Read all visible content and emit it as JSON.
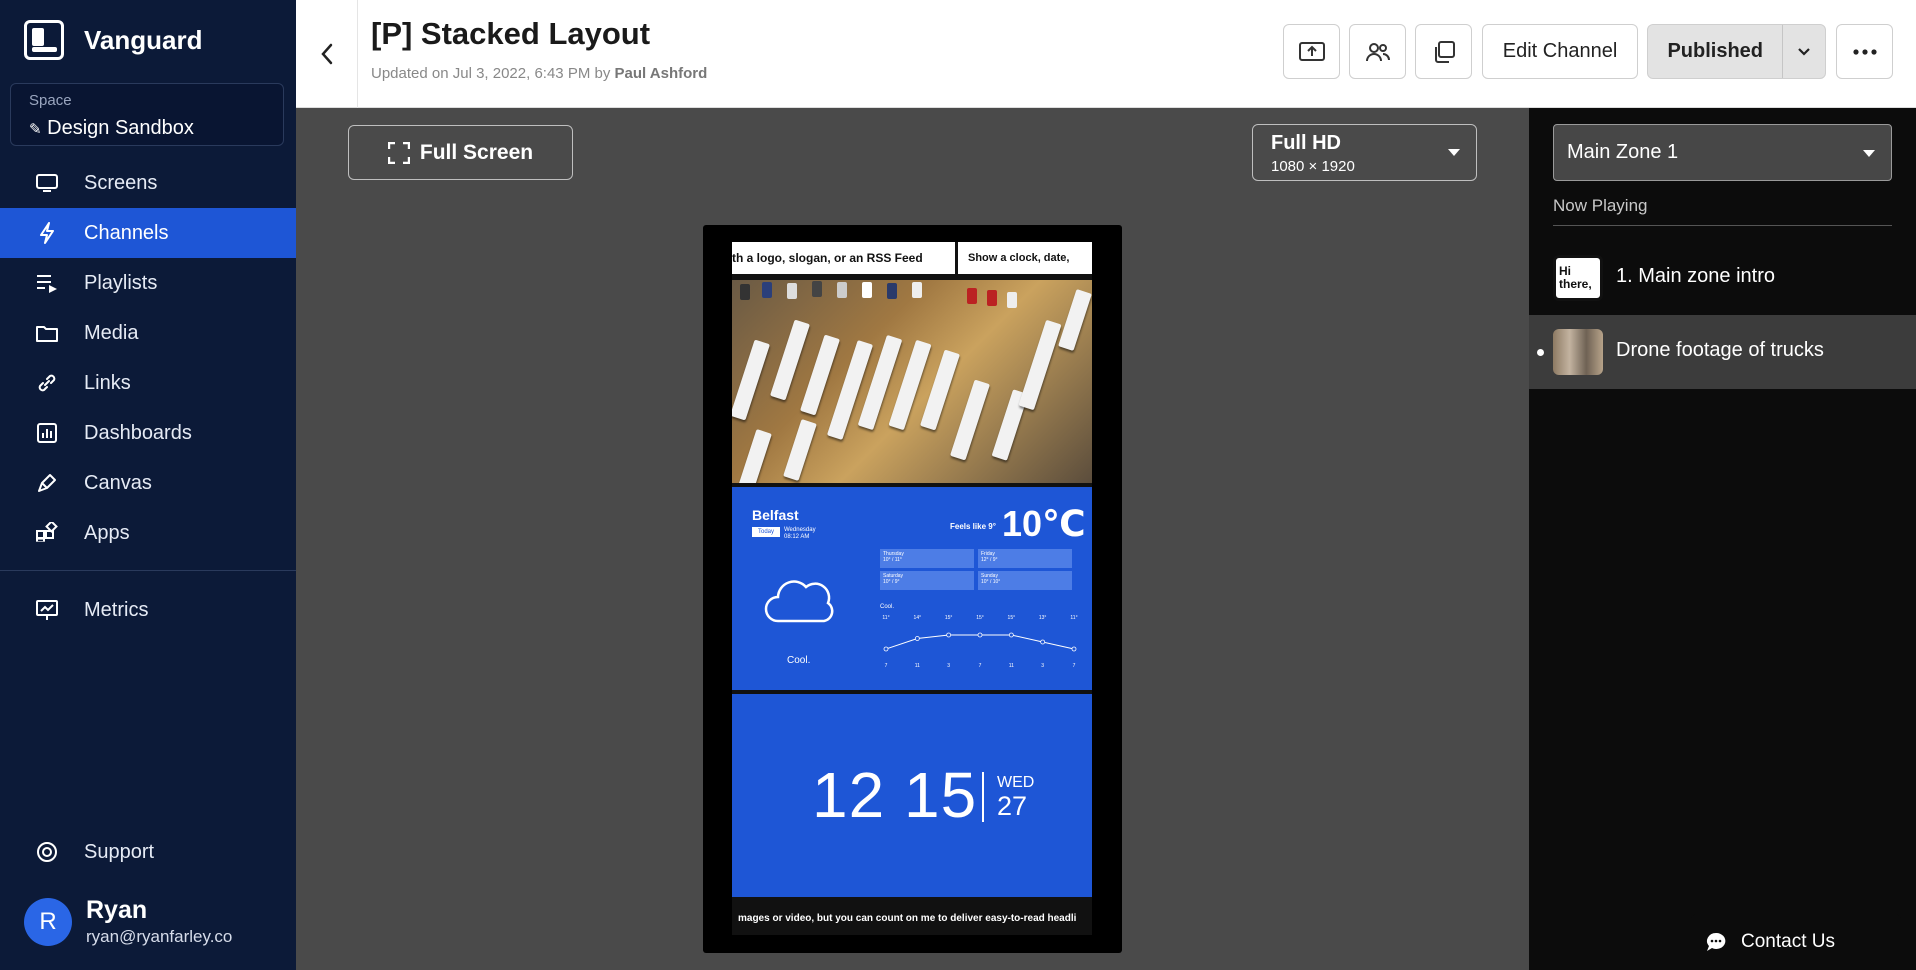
{
  "app": {
    "name": "Vanguard"
  },
  "space": {
    "label": "Space",
    "name": "Design Sandbox"
  },
  "nav": {
    "items": [
      {
        "label": "Screens",
        "icon": "monitor-icon"
      },
      {
        "label": "Channels",
        "icon": "lightning-icon",
        "active": true
      },
      {
        "label": "Playlists",
        "icon": "playlist-icon"
      },
      {
        "label": "Media",
        "icon": "folder-icon"
      },
      {
        "label": "Links",
        "icon": "link-icon"
      },
      {
        "label": "Dashboards",
        "icon": "dashboard-icon"
      },
      {
        "label": "Canvas",
        "icon": "pen-icon"
      },
      {
        "label": "Apps",
        "icon": "apps-icon"
      }
    ],
    "metrics": "Metrics",
    "support": "Support"
  },
  "user": {
    "initial": "R",
    "name": "Ryan",
    "email": "ryan@ryanfarley.co"
  },
  "header": {
    "title": "[P] Stacked Layout",
    "updated_prefix": "Updated on Jul 3, 2022, 6:43 PM by ",
    "updated_by": "Paul Ashford",
    "edit_label": "Edit Channel",
    "publish_label": "Published"
  },
  "toolbar": {
    "fullscreen_label": "Full Screen",
    "resolution_name": "Full HD",
    "resolution_dims": "1080 × 1920"
  },
  "preview": {
    "ticker_left": "th a logo, slogan, or an RSS Feed",
    "ticker_right": "Show a clock, date,",
    "weather": {
      "city": "Belfast",
      "today": "Today",
      "date_line1": "Wednesday",
      "date_line2": "08:12 AM",
      "feels_like": "Feels like 9°",
      "temp": "10℃",
      "description": "Cool.",
      "forecast": [
        {
          "day": "Thursday",
          "range": "10° / 11°"
        },
        {
          "day": "Friday",
          "range": "12° / 9°"
        },
        {
          "day": "Saturday",
          "range": "10° / 9°"
        },
        {
          "day": "Sunday",
          "range": "10° / 10°"
        }
      ],
      "chart_label": "Cool.",
      "hourly_temps": [
        "11°",
        "14°",
        "15°",
        "15°",
        "15°",
        "13°",
        "11°"
      ],
      "hourly_times": [
        "7",
        "11",
        "3",
        "7",
        "11",
        "3",
        "7"
      ]
    },
    "clock": {
      "time": "12 15",
      "weekday": "WED",
      "day": "27"
    },
    "ticker_bottom": "mages or video, but you can count on me to deliver easy-to-read headli"
  },
  "right_panel": {
    "zone": "Main Zone 1",
    "now_playing_label": "Now Playing",
    "items": [
      {
        "title": "1. Main zone intro",
        "thumb_text": "Hi there,"
      },
      {
        "title": "Drone footage of trucks"
      }
    ]
  },
  "contact": {
    "label": "Contact Us"
  }
}
